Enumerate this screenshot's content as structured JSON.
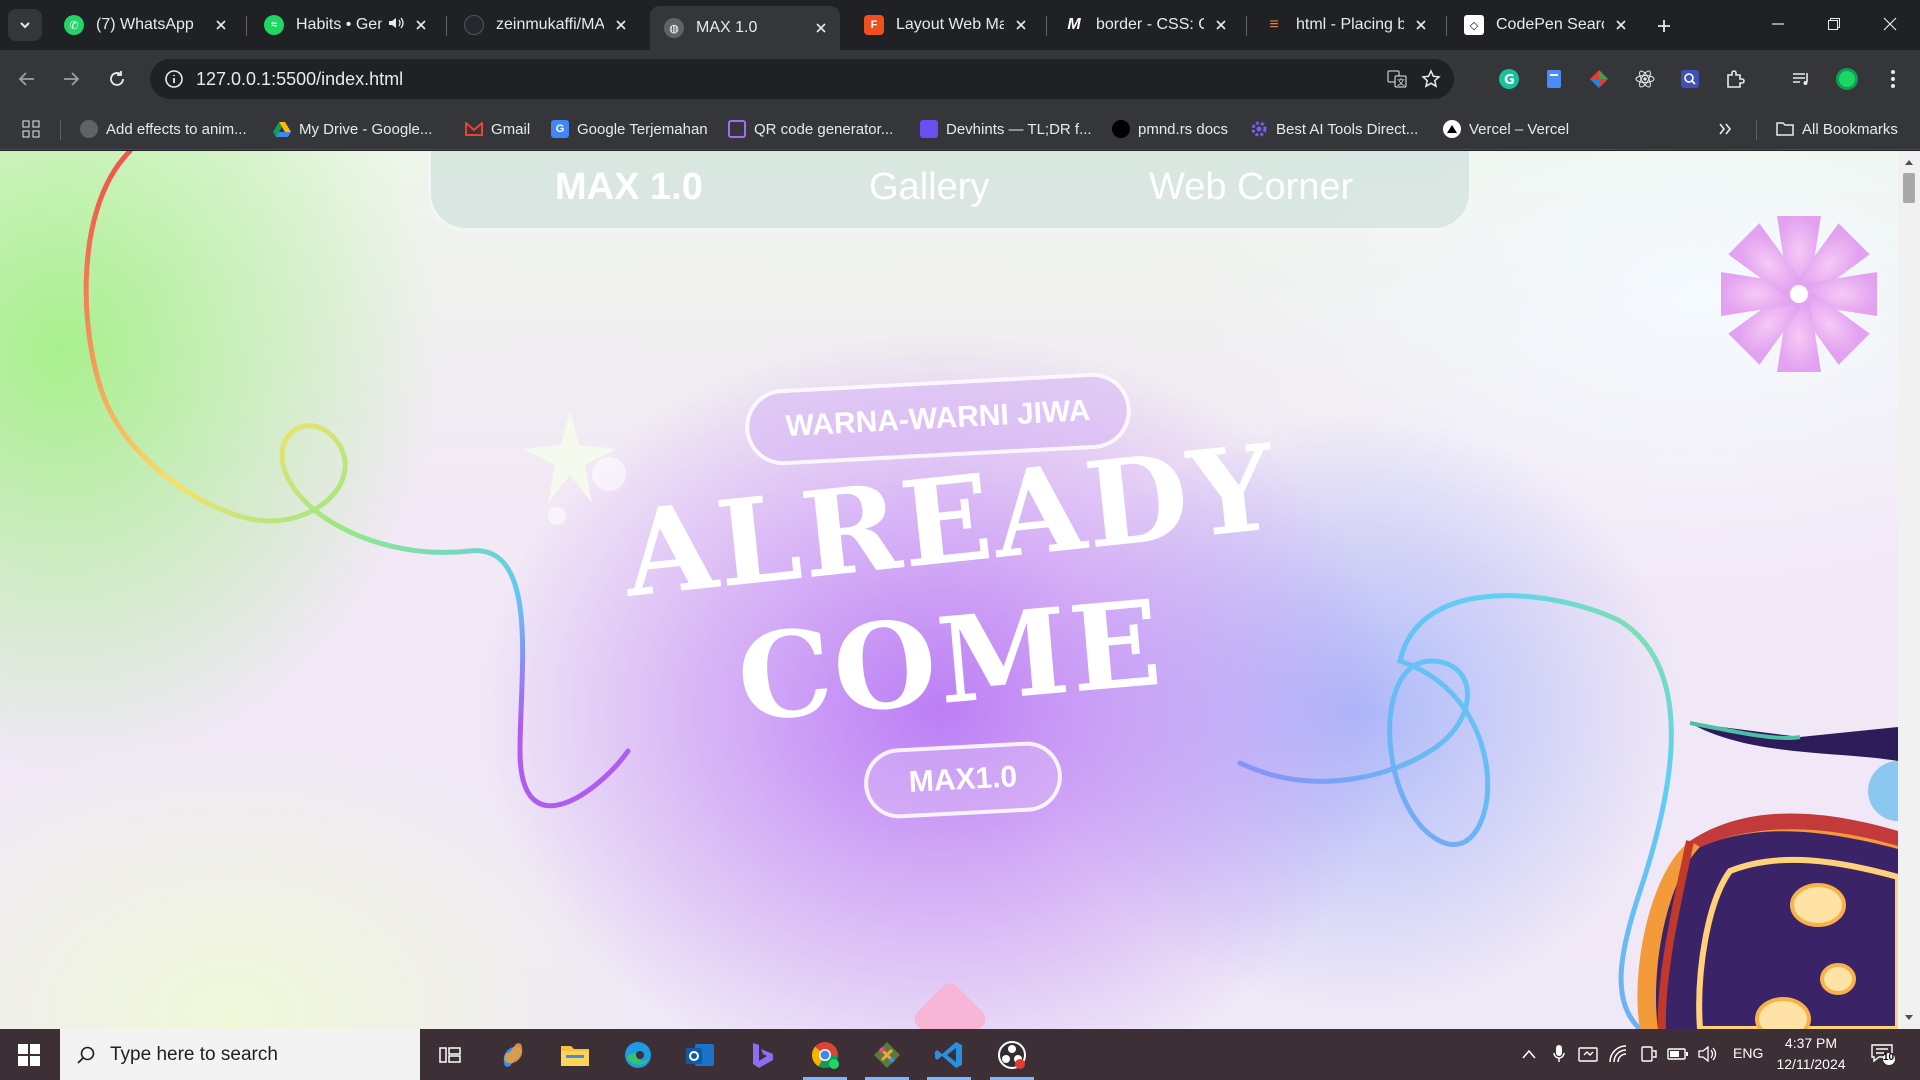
{
  "browser": {
    "tabs": [
      {
        "title": "(7) WhatsApp",
        "icon": "whatsapp-icon",
        "color": "#25d366"
      },
      {
        "title": "Habits • Gen",
        "icon": "spotify-icon",
        "color": "#1ed760"
      },
      {
        "title": "zeinmukaffi/MA",
        "icon": "github-icon",
        "color": "#24292f"
      },
      {
        "title": "MAX 1.0",
        "icon": "globe-icon",
        "color": "#9aa0a6"
      },
      {
        "title": "Layout Web Max",
        "icon": "figma-icon",
        "color": "#f24e1e"
      },
      {
        "title": "border - CSS: Ca",
        "icon": "mdn-icon",
        "color": "#ffffff"
      },
      {
        "title": "html - Placing bo",
        "icon": "stackoverflow-icon",
        "color": "#f48024"
      },
      {
        "title": "CodePen Search",
        "icon": "codepen-icon",
        "color": "#ffffff"
      }
    ],
    "active_tab_index": 3,
    "url": "127.0.0.1:5500/index.html",
    "bookmarks": [
      {
        "label": "Add effects to anim...",
        "icon": "globe-icon"
      },
      {
        "label": "My Drive - Google...",
        "icon": "google-drive-icon"
      },
      {
        "label": "Gmail",
        "icon": "gmail-icon"
      },
      {
        "label": "Google Terjemahan",
        "icon": "google-translate-icon"
      },
      {
        "label": "QR code generator...",
        "icon": "qr-icon"
      },
      {
        "label": "Devhints — TL;DR f...",
        "icon": "devhints-icon"
      },
      {
        "label": "pmnd.rs docs",
        "icon": "pmndrs-icon"
      },
      {
        "label": "Best AI Tools Direct...",
        "icon": "gear-icon"
      },
      {
        "label": "Vercel – Vercel",
        "icon": "vercel-icon"
      }
    ],
    "all_bookmarks_label": "All Bookmarks"
  },
  "page": {
    "nav": {
      "brand": "MAX 1.0",
      "links": [
        "Gallery",
        "Web Corner"
      ]
    },
    "hero": {
      "top_pill": "WARNA-WARNI JIWA",
      "headline_line1": "ALREADY",
      "headline_line2": "COME",
      "bottom_pill": "MAX1.0"
    },
    "colors": {
      "accent_purple": "#b47af2",
      "accent_blue": "#8fb0ff",
      "accent_green": "#a8f08a",
      "ribbon_red": "#f25a5a"
    }
  },
  "taskbar": {
    "search_placeholder": "Type here to search",
    "apps": [
      "task-view-icon",
      "copilot-icon",
      "file-explorer-icon",
      "edge-icon",
      "outlook-icon",
      "bing-icon",
      "chrome-icon",
      "git-icon",
      "vscode-icon",
      "obs-icon"
    ],
    "language": "ENG",
    "time": "4:37 PM",
    "date": "12/11/2024",
    "notification_count": "10"
  }
}
